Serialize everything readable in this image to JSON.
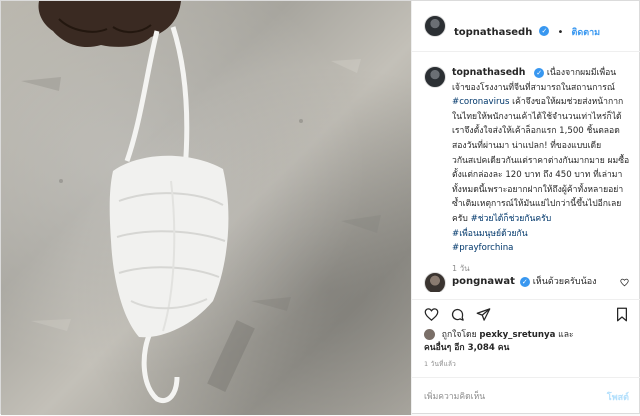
{
  "post": {
    "author": "topnathasedh",
    "follow_label": "ติดตาม",
    "dot": "•",
    "caption_parts": {
      "text1": "เนื่องจากผมมีเพื่อนเจ้าของโรงงานที่จีนที่สามารถในสถานการณ์",
      "tag1": "#coronavirus",
      "text2": "เค้าจึงขอให้ผมช่วยส่งหน้ากากในไทยให้พนักงานเค้าได้ใช้จำนวนเท่าไหร่ก็ได้ เราจึงตั้งใจส่งให้เค้าล็อกแรก 1,500 ชิ้นตลอดสองวันที่ผ่านมา น่าแปลก! ที่ของแบบเดียวกันสเปคเดียวกันแต่ราคาต่างกันมากมาย ผมซื้อตั้งแต่กล่องละ 120 บาท ถึง 450 บาท ที่เล่ามาทั้งหมดนี้เพราะอยากฝากให้ถึงผู้ค้าทั้งหลายอย่าซ้ำเติมเหตุการณ์ให้มันแย่ไปกว่านี้ขึ้นไปอีกเลยครับ",
      "tag2": "#ช่วยได้ก็ช่วยกันครับ",
      "tag3": "#เพื่อนมนุษย์ด้วยกัน",
      "tag4": "#prayforchina"
    },
    "caption_time": "1 วัน",
    "comment": {
      "username": "pongnawat",
      "text": "เห็นด้วยครับน้อง"
    },
    "likes": {
      "prefix": "ถูกใจโดย",
      "user": "pexky_sretunya",
      "mid": "และ",
      "others": "คนอื่นๆ อีก 3,084 คน"
    },
    "posted_ago": "1 วันที่แล้ว",
    "add_comment_placeholder": "เพิ่มความคิดเห็น",
    "post_button": "โพสต์"
  },
  "icons": [
    "heart-icon",
    "comment-icon",
    "share-icon",
    "bookmark-icon",
    "verified-icon",
    "small-heart-icon"
  ],
  "colors": {
    "link": "#3897f0",
    "hashtag": "#00376b",
    "muted": "#8e8e8e",
    "post_disabled": "#b2dffc"
  }
}
